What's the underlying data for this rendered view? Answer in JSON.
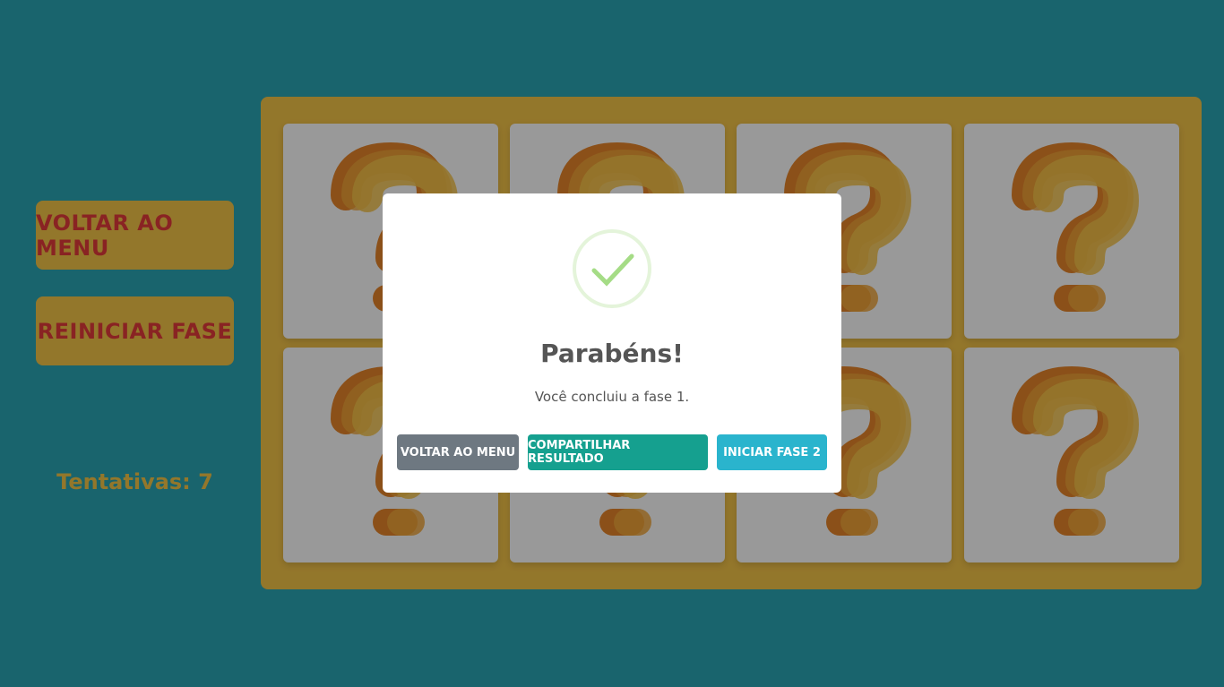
{
  "sidebar": {
    "menu_label": "VOLTAR AO MENU",
    "restart_label": "REINICIAR FASE",
    "attempts_text": "Tentativas: 7"
  },
  "board": {
    "cards": [
      {
        "face": "question-mark-icon"
      },
      {
        "face": "question-mark-icon"
      },
      {
        "face": "question-mark-icon"
      },
      {
        "face": "question-mark-icon"
      },
      {
        "face": "question-mark-icon"
      },
      {
        "face": "question-mark-icon"
      },
      {
        "face": "question-mark-icon"
      },
      {
        "face": "question-mark-icon"
      }
    ]
  },
  "modal": {
    "icon": "success-check-icon",
    "title": "Parabéns!",
    "text": "Você concluiu a fase 1.",
    "menu_label": "VOLTAR AO MENU",
    "share_label": "COMPARTILHAR RESULTADO",
    "next_label": "INICIAR FASE 2"
  },
  "colors": {
    "background": "#2aa7b6",
    "board": "#f6c649",
    "side_text": "#e43b3b",
    "secondary_button": "#6e7881",
    "share_button": "#15a08f",
    "next_button": "#2ab4cd",
    "check": "#a5dc86"
  }
}
